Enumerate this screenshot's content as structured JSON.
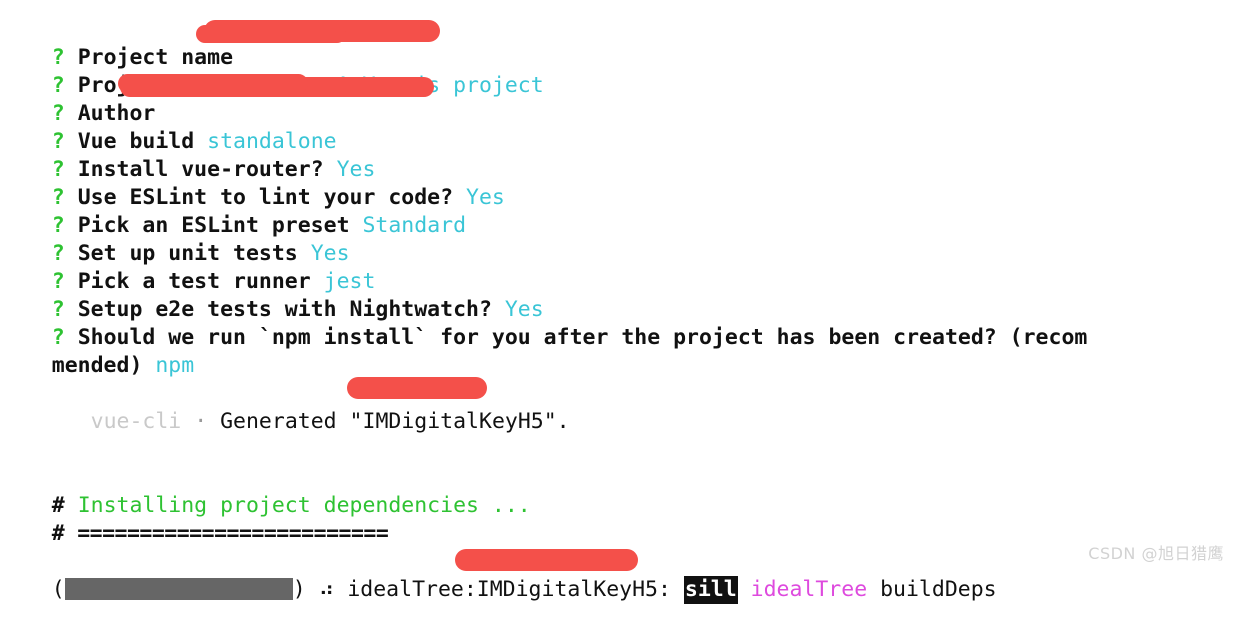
{
  "terminal": {
    "prompt_symbol": "?",
    "questions": [
      {
        "label": "Project name",
        "answer": "",
        "redacted": true
      },
      {
        "label": "Project description",
        "answer": "A Vue.js project",
        "redacted": false
      },
      {
        "label": "Author",
        "answer": "",
        "redacted": true
      },
      {
        "label": "Vue build",
        "answer": "standalone",
        "redacted": false
      },
      {
        "label": "Install vue-router?",
        "answer": "Yes",
        "redacted": false
      },
      {
        "label": "Use ESLint to lint your code?",
        "answer": "Yes",
        "redacted": false
      },
      {
        "label": "Pick an ESLint preset",
        "answer": "Standard",
        "redacted": false
      },
      {
        "label": "Set up unit tests",
        "answer": "Yes",
        "redacted": false
      },
      {
        "label": "Pick a test runner",
        "answer": "jest",
        "redacted": false
      },
      {
        "label": "Setup e2e tests with Nightwatch?",
        "answer": "Yes",
        "redacted": false
      }
    ],
    "wrapped_question": {
      "line1": "Should we run `npm install` for you after the project has been created? (recom",
      "line2_prefix": "mended) ",
      "line2_answer": "npm"
    },
    "generated": {
      "tool": "vue-cli",
      "separator": "·",
      "verb": "Generated",
      "quote_open": "\"",
      "project": "IMDigitalKeyH5",
      "quote_close": "\".",
      "redacted": true
    },
    "installing": {
      "hash": "#",
      "text": "Installing project dependencies ...",
      "rule_hash": "#",
      "rule": "========================="
    },
    "npm_log": {
      "paren_open": "(",
      "paren_close": ")",
      "progress_percent": 100,
      "spinner": "⠴",
      "path": "idealTree:IMDigitalKeyH5:",
      "level": "sill",
      "scope": "idealTree",
      "message": "buildDeps",
      "redacted": true
    }
  },
  "watermark": {
    "text": "CSDN @旭日猎鹰"
  },
  "colors": {
    "background": "#ffffff",
    "question_mark_green": "#2ec232",
    "answer_cyan": "#3ac5d6",
    "text_black": "#111111",
    "dim_gray": "#c9c9c9",
    "redaction_red": "#f4504a",
    "log_magenta": "#de4ade",
    "progress_gray": "#666666",
    "watermark_gray": "#d2d2d2"
  }
}
